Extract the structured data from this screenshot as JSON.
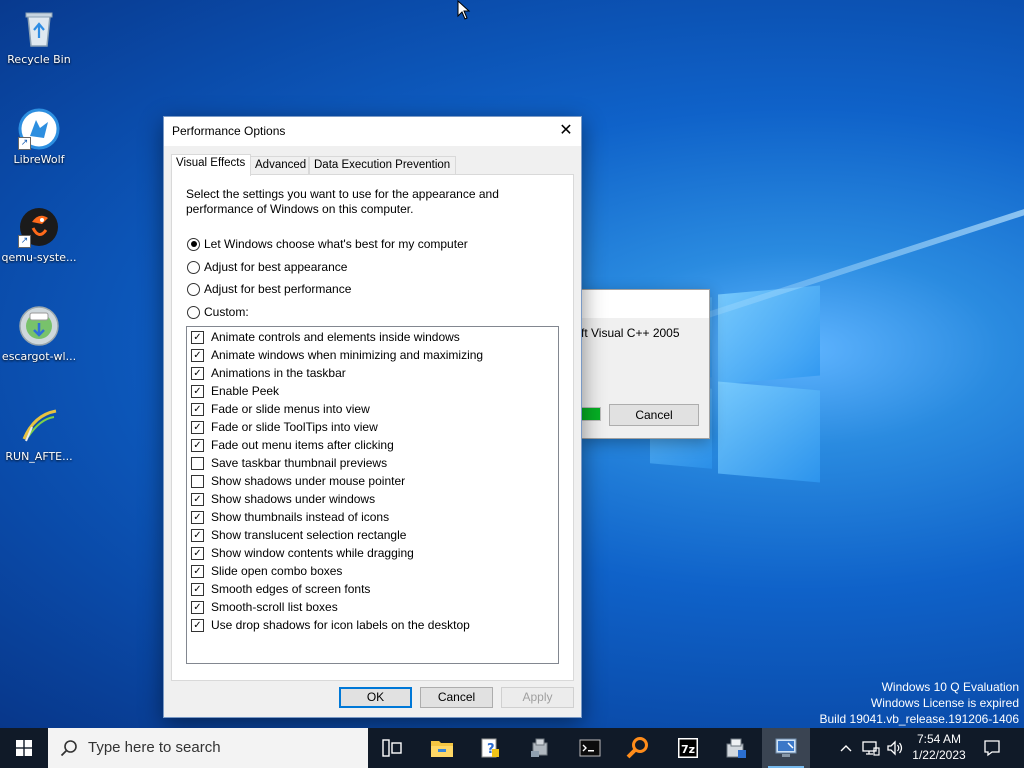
{
  "desktop": {
    "icons": [
      {
        "label": "Recycle Bin",
        "icon": "recycle-bin-icon"
      },
      {
        "label": "LibreWolf",
        "icon": "librewolf-icon"
      },
      {
        "label": "qemu-syste...",
        "icon": "qemu-icon"
      },
      {
        "label": "escargot-wl...",
        "icon": "escargot-icon"
      },
      {
        "label": "RUN_AFTE...",
        "icon": "script-icon"
      }
    ],
    "watermark": {
      "line1": "Windows 10 Q Evaluation",
      "line2": "Windows License is expired",
      "line3": "Build 19041.vb_release.191206-1406"
    }
  },
  "background_dialog": {
    "text": "ft Visual C++ 2005",
    "cancel_label": "Cancel",
    "progress": 1.0
  },
  "perf_dialog": {
    "title": "Performance Options",
    "close_glyph": "✕",
    "tabs": [
      {
        "label": "Visual Effects",
        "active": true
      },
      {
        "label": "Advanced",
        "active": false
      },
      {
        "label": "Data Execution Prevention",
        "active": false
      }
    ],
    "intro": "Select the settings you want to use for the appearance and performance of Windows on this computer.",
    "radios": [
      {
        "label": "Let Windows choose what's best for my computer",
        "selected": true
      },
      {
        "label": "Adjust for best appearance",
        "selected": false
      },
      {
        "label": "Adjust for best performance",
        "selected": false
      },
      {
        "label": "Custom:",
        "selected": false
      }
    ],
    "options": [
      {
        "label": "Animate controls and elements inside windows",
        "checked": true
      },
      {
        "label": "Animate windows when minimizing and maximizing",
        "checked": true
      },
      {
        "label": "Animations in the taskbar",
        "checked": true
      },
      {
        "label": "Enable Peek",
        "checked": true
      },
      {
        "label": "Fade or slide menus into view",
        "checked": true
      },
      {
        "label": "Fade or slide ToolTips into view",
        "checked": true
      },
      {
        "label": "Fade out menu items after clicking",
        "checked": true
      },
      {
        "label": "Save taskbar thumbnail previews",
        "checked": false
      },
      {
        "label": "Show shadows under mouse pointer",
        "checked": false
      },
      {
        "label": "Show shadows under windows",
        "checked": true
      },
      {
        "label": "Show thumbnails instead of icons",
        "checked": true
      },
      {
        "label": "Show translucent selection rectangle",
        "checked": true
      },
      {
        "label": "Show window contents while dragging",
        "checked": true
      },
      {
        "label": "Slide open combo boxes",
        "checked": true
      },
      {
        "label": "Smooth edges of screen fonts",
        "checked": true
      },
      {
        "label": "Smooth-scroll list boxes",
        "checked": true
      },
      {
        "label": "Use drop shadows for icon labels on the desktop",
        "checked": true
      }
    ],
    "buttons": {
      "ok": "OK",
      "cancel": "Cancel",
      "apply": "Apply"
    }
  },
  "taskbar": {
    "search_placeholder": "Type here to search",
    "items": [
      {
        "icon": "task-view-icon"
      },
      {
        "icon": "file-explorer-icon"
      },
      {
        "icon": "help-file-icon"
      },
      {
        "icon": "setup-installer-icon"
      },
      {
        "icon": "command-prompt-icon"
      },
      {
        "icon": "search-tool-icon"
      },
      {
        "icon": "7zip-icon"
      },
      {
        "icon": "installer-package-icon"
      },
      {
        "icon": "system-properties-icon"
      }
    ],
    "time": "7:54 AM",
    "date": "1/22/2023"
  }
}
